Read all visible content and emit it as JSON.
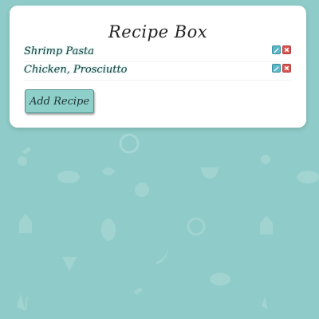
{
  "app": {
    "title": "Recipe Box"
  },
  "recipes": [
    {
      "name": "Shrimp Pasta"
    },
    {
      "name": "Chicken, Prosciutto"
    }
  ],
  "actions": {
    "add_label": "Add Recipe"
  },
  "icons": {
    "edit": "pencil-icon",
    "delete": "close-icon"
  },
  "colors": {
    "background": "#8fcbc8",
    "card": "#ffffff",
    "edit_button": "#5cb8c9",
    "delete_button": "#d9534f",
    "add_button": "#8ecfc9"
  }
}
